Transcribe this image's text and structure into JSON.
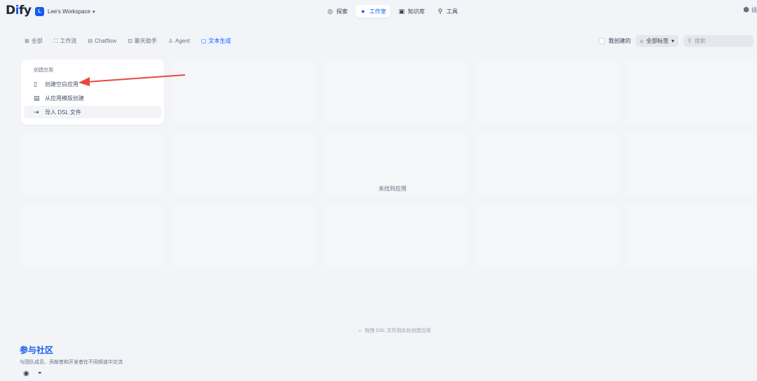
{
  "header": {
    "logo_prefix": "D",
    "logo_i": "i",
    "logo_suffix": "fy",
    "workspace_initial": "L",
    "workspace_name": "Lee's Workspace",
    "nav": [
      {
        "label": "探索",
        "icon": "explore-icon"
      },
      {
        "label": "工作室",
        "icon": "studio-icon"
      },
      {
        "label": "知识库",
        "icon": "knowledge-icon"
      },
      {
        "label": "工具",
        "icon": "tools-icon"
      }
    ],
    "right_label": "插"
  },
  "filters": {
    "items": [
      "全部",
      "工作流",
      "Chatflow",
      "聊天助手",
      "Agent",
      "文本生成"
    ],
    "active": "文本生成",
    "mine_label": "我创建的",
    "tags_label": "全部标签",
    "search_placeholder": "搜索"
  },
  "create_card": {
    "title": "创建应用",
    "items": [
      {
        "label": "创建空白应用",
        "icon": "file-icon"
      },
      {
        "label": "从应用模版创建",
        "icon": "template-icon"
      },
      {
        "label": "导入 DSL 文件",
        "icon": "import-icon"
      }
    ]
  },
  "empty_state": "未找到应用",
  "drop_hint": "拖拽 DSL 文件到此处创建应用",
  "community": {
    "title": "参与社区",
    "subtitle": "与团队成员、贡献者和开发者在不同频道中交流",
    "links": [
      "github-icon",
      "discord-icon"
    ]
  },
  "colors": {
    "accent": "#155eef",
    "background": "#f2f4f7",
    "arrow": "#e8473e"
  }
}
